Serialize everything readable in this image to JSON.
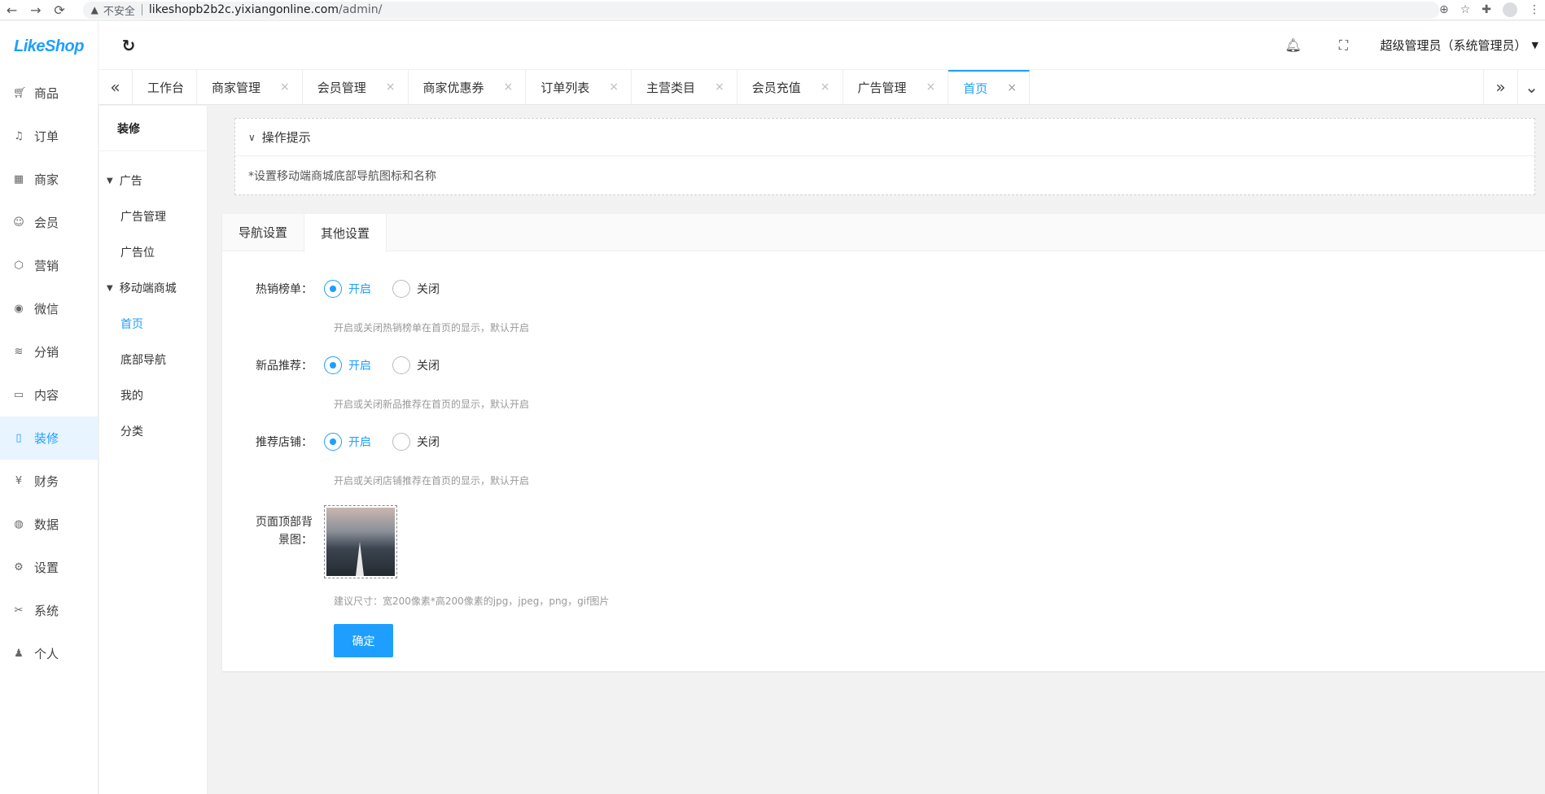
{
  "browser": {
    "insecure_label": "不安全",
    "url_host": "likeshopb2b2c.yixiangonline.com",
    "url_path": "/admin/"
  },
  "app": {
    "logo_text": "LikeShop"
  },
  "sidebar": {
    "items": [
      {
        "label": "商品",
        "icon": "cart-icon"
      },
      {
        "label": "订单",
        "icon": "bell-icon"
      },
      {
        "label": "商家",
        "icon": "building-icon"
      },
      {
        "label": "会员",
        "icon": "user-icon"
      },
      {
        "label": "营销",
        "icon": "cube-icon"
      },
      {
        "label": "微信",
        "icon": "wechat-icon"
      },
      {
        "label": "分销",
        "icon": "layers-icon"
      },
      {
        "label": "内容",
        "icon": "content-icon"
      },
      {
        "label": "装修",
        "icon": "mobile-icon"
      },
      {
        "label": "财务",
        "icon": "yen-icon"
      },
      {
        "label": "数据",
        "icon": "globe-icon"
      },
      {
        "label": "设置",
        "icon": "gear-icon"
      },
      {
        "label": "系统",
        "icon": "tools-icon"
      },
      {
        "label": "个人",
        "icon": "person-icon"
      }
    ],
    "active_index": 8
  },
  "topbar": {
    "user_label": "超级管理员（系统管理员）"
  },
  "tabs": [
    {
      "label": "工作台",
      "closable": false
    },
    {
      "label": "商家管理",
      "closable": true
    },
    {
      "label": "会员管理",
      "closable": true
    },
    {
      "label": "商家优惠券",
      "closable": true
    },
    {
      "label": "订单列表",
      "closable": true
    },
    {
      "label": "主营类目",
      "closable": true
    },
    {
      "label": "会员充值",
      "closable": true
    },
    {
      "label": "广告管理",
      "closable": true
    },
    {
      "label": "首页",
      "closable": true,
      "active": true
    }
  ],
  "subsidebar": {
    "title": "装修",
    "groups": [
      {
        "title": "广告",
        "items": [
          "广告管理",
          "广告位"
        ]
      },
      {
        "title": "移动端商城",
        "items": [
          "首页",
          "底部导航",
          "我的",
          "分类"
        ]
      }
    ],
    "active_item": "首页"
  },
  "tips": {
    "title": "操作提示",
    "text": "*设置移动端商城底部导航图标和名称"
  },
  "settings": {
    "tabs": [
      "导航设置",
      "其他设置"
    ],
    "active_tab": "其他设置",
    "on_label": "开启",
    "off_label": "关闭",
    "rows": [
      {
        "label": "热销榜单：",
        "value": "on",
        "hint": "开启或关闭热销榜单在首页的显示，默认开启"
      },
      {
        "label": "新品推荐：",
        "value": "on",
        "hint": "开启或关闭新品推荐在首页的显示，默认开启"
      },
      {
        "label": "推荐店铺：",
        "value": "on",
        "hint": "开启或关闭店铺推荐在首页的显示，默认开启"
      }
    ],
    "bg_label_line1": "页面顶部背",
    "bg_label_line2": "景图：",
    "bg_hint": "建议尺寸：宽200像素*高200像素的jpg，jpeg，png，gif图片",
    "submit_label": "确定"
  },
  "colors": {
    "accent": "#1e9fff"
  }
}
